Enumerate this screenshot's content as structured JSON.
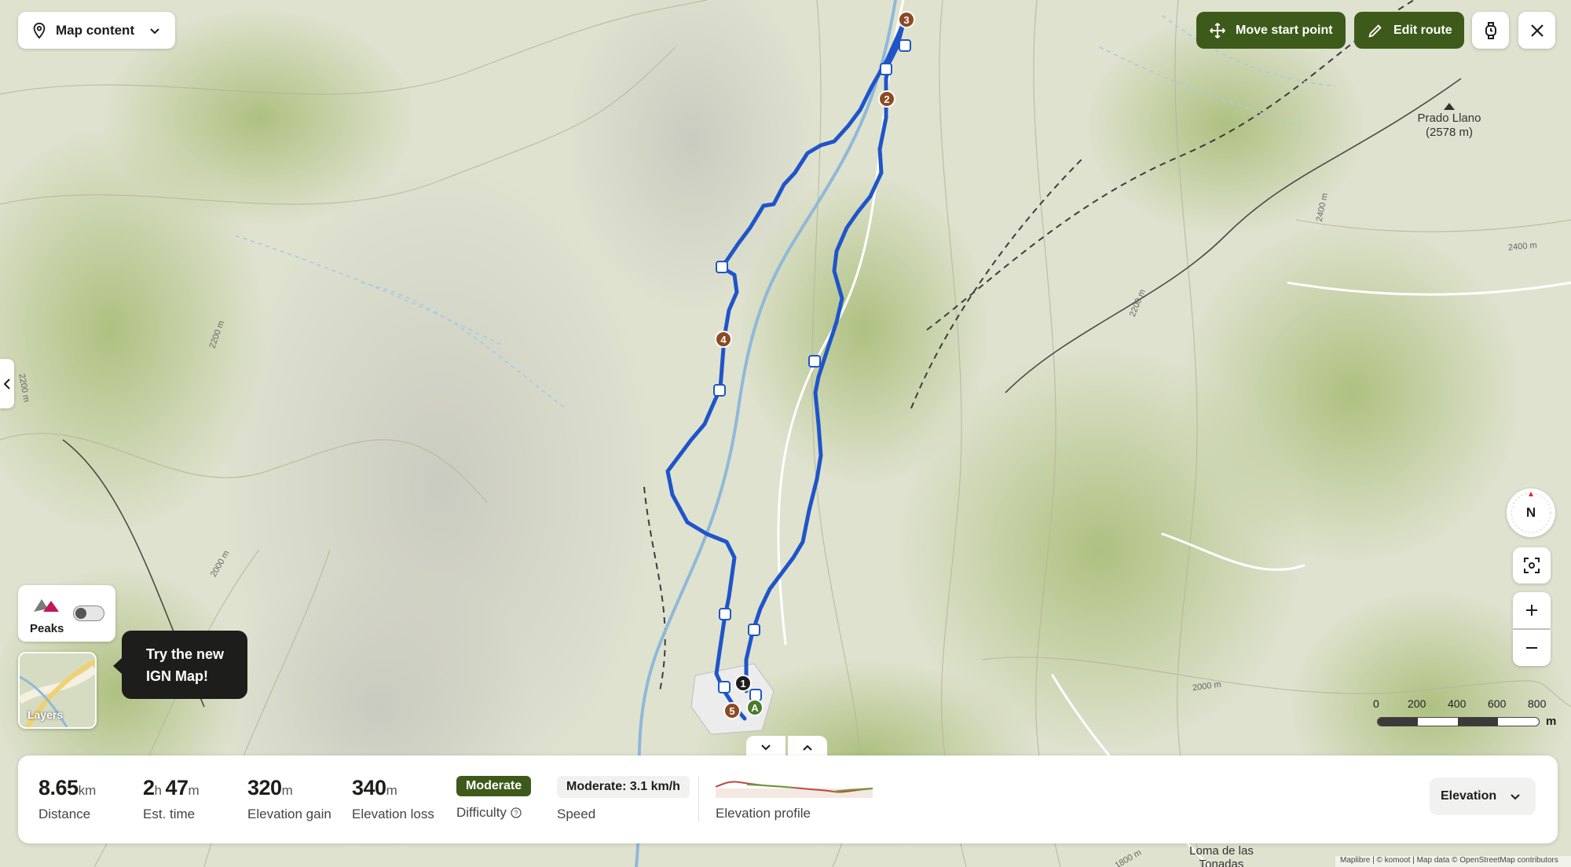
{
  "toolbar": {
    "map_content_label": "Map content",
    "move_start_label": "Move start point",
    "edit_route_label": "Edit route"
  },
  "layers": {
    "peaks_label": "Peaks",
    "layers_label": "Layers",
    "tooltip_line1": "Try the new",
    "tooltip_line2": "IGN Map!"
  },
  "compass": {
    "label": "N"
  },
  "map_labels": {
    "peak_name": "Prado Llano",
    "peak_elev": "(2578 m)",
    "place_line1": "Loma de las",
    "place_line2": "Tonadas",
    "contour_2400_a": "2400 m",
    "contour_2400_b": "2400 m",
    "contour_2200_a": "2200 m",
    "contour_2200_b": "2200 m",
    "contour_2200_c": "2200 m",
    "contour_2000_a": "2000 m",
    "contour_2000_b": "2000 m",
    "contour_1800": "1800 m",
    "attribution": "Maplibre | © komoot | Map data © OpenStreetMap contributors"
  },
  "waypoints": [
    "1",
    "2",
    "3",
    "4",
    "5"
  ],
  "start_marker": "A",
  "scale": {
    "ticks": [
      "0",
      "200",
      "400",
      "600",
      "800"
    ],
    "unit": "m"
  },
  "stats": {
    "distance": {
      "value": "8.65",
      "unit": "km",
      "label": "Distance"
    },
    "time": {
      "hours": "2",
      "h_unit": "h",
      "minutes": "47",
      "m_unit": "m",
      "label": "Est. time"
    },
    "gain": {
      "value": "320",
      "unit": "m",
      "label": "Elevation gain"
    },
    "loss": {
      "value": "340",
      "unit": "m",
      "label": "Elevation loss"
    },
    "difficulty": {
      "badge": "Moderate",
      "label": "Difficulty"
    },
    "speed": {
      "value": "Moderate: 3.1 km/h",
      "label": "Speed"
    },
    "profile": {
      "label": "Elevation profile"
    }
  },
  "elevation_dropdown": "Elevation",
  "colors": {
    "route": "#1f55c9",
    "green_button": "#3d5a1a",
    "waypoint": "#8b4a22",
    "start": "#4b7a2a",
    "badge": "#3d5a1a"
  }
}
